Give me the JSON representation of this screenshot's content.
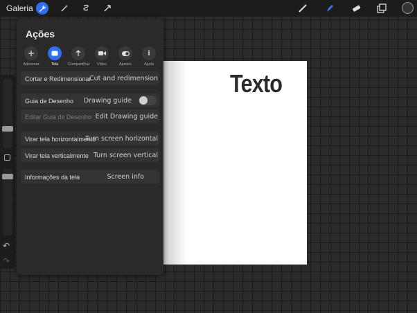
{
  "topbar": {
    "gallery_label": "Galeria",
    "icons": [
      "wrench-icon",
      "magic-wand-icon",
      "selection-icon",
      "transform-arrow-icon"
    ],
    "right_tools": [
      "brush-icon",
      "smudge-icon",
      "eraser-icon",
      "layers-icon",
      "color-icon"
    ]
  },
  "canvas": {
    "text": "Texto"
  },
  "actions_panel": {
    "title": "Ações",
    "tabs": [
      {
        "label": "Adicionar",
        "icon": "plus-icon"
      },
      {
        "label": "Tela",
        "icon": "canvas-icon"
      },
      {
        "label": "Compartilhar",
        "icon": "share-icon"
      },
      {
        "label": "Vídeo",
        "icon": "video-icon"
      },
      {
        "label": "Ajustes",
        "icon": "toggle-icon"
      },
      {
        "label": "Ajuda",
        "icon": "info-icon"
      }
    ],
    "rows": {
      "crop_resize": {
        "label": "Cortar e Redimensionar",
        "overlay": "Cut and redimension"
      },
      "drawing_guide": {
        "label": "Guia de Desenho",
        "overlay": "Drawing guide"
      },
      "edit_drawing_guide": {
        "label": "Editar Guia de Desenho",
        "overlay": "Edit Drawing guide"
      },
      "flip_horizontal": {
        "label": "Virar tela horizontalmente",
        "overlay": "Turn screen horizontal"
      },
      "flip_vertical": {
        "label": "Virar tela verticalmente",
        "overlay": "Turn screen vertical"
      },
      "canvas_info": {
        "label": "Informações da tela",
        "overlay": "Screen info"
      }
    },
    "drawing_guide_on": false
  },
  "colors": {
    "accent": "#2f6ff0"
  }
}
